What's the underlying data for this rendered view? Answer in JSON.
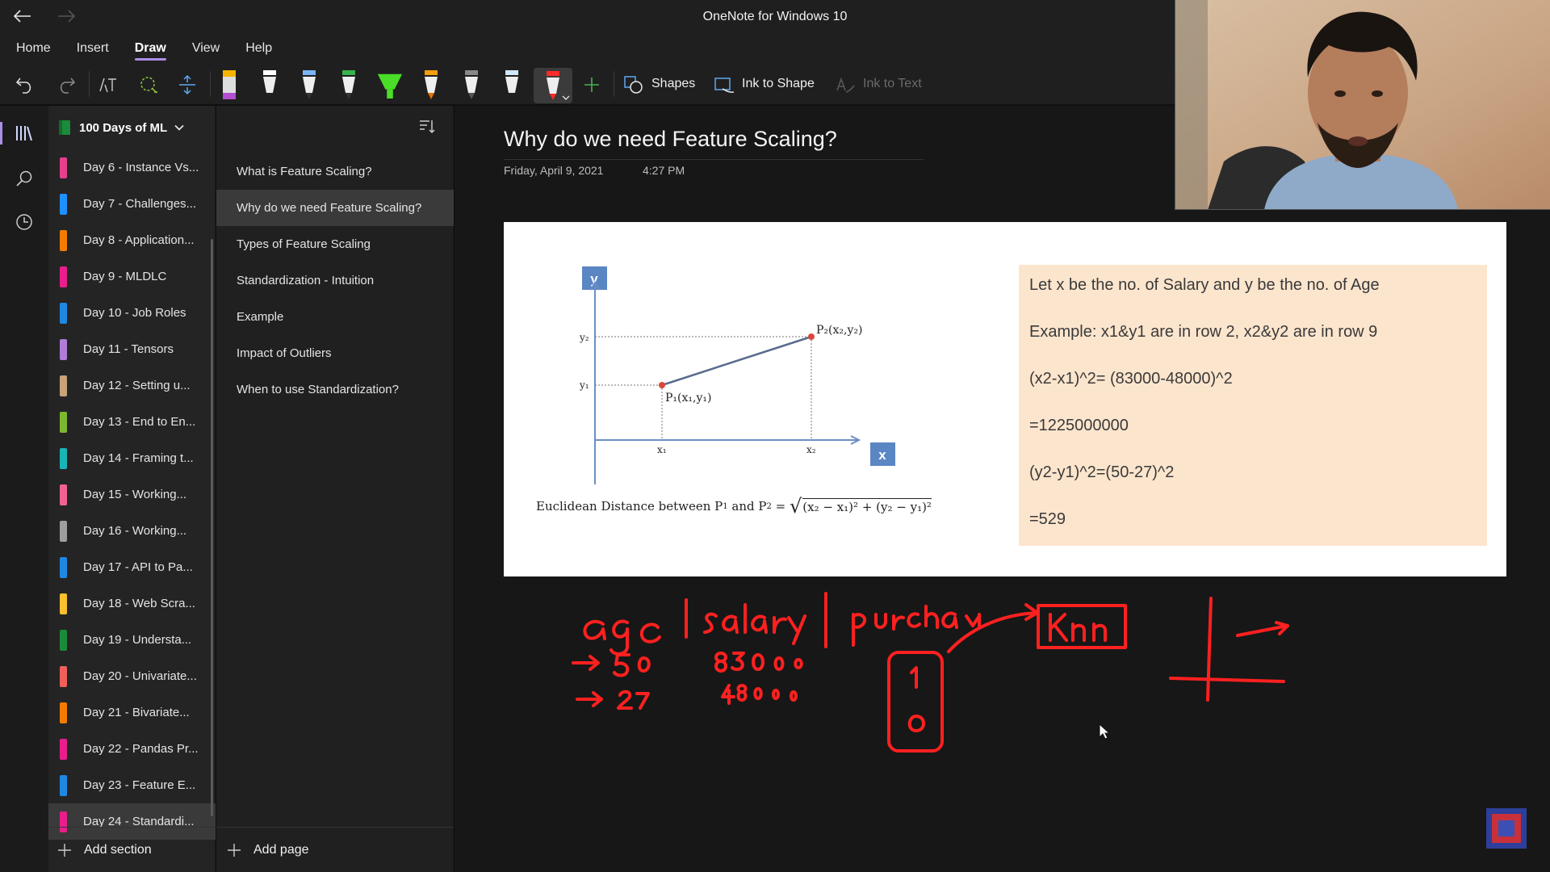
{
  "app": {
    "title": "OneNote for Windows 10"
  },
  "menu": {
    "tabs": [
      {
        "label": "Home"
      },
      {
        "label": "Insert"
      },
      {
        "label": "Draw"
      },
      {
        "label": "View"
      },
      {
        "label": "Help"
      }
    ],
    "active": "Draw"
  },
  "toolbar": {
    "shapes_label": "Shapes",
    "ink_to_shape_label": "Ink to Shape",
    "ink_to_text_label": "Ink to Text",
    "pens": [
      {
        "color": "#f4b400",
        "name": "highlighter-pen"
      },
      {
        "color": "#ffffff",
        "name": "white-pen"
      },
      {
        "color": "#7ab4f5",
        "name": "blue-pen"
      },
      {
        "color": "#37b24d",
        "name": "green-pen"
      },
      {
        "color": "#4ade28",
        "name": "green-highlighter"
      },
      {
        "color": "#f59e0b",
        "name": "orange-pen"
      },
      {
        "color": "#d0d0d0",
        "name": "gray-pen"
      },
      {
        "color": "#cfe8ff",
        "name": "light-blue-pen"
      },
      {
        "color": "#ff2a2a",
        "name": "red-pen"
      }
    ]
  },
  "notebook": {
    "name": "100 Days of ML"
  },
  "sections": [
    {
      "label": "Day 6 - Instance Vs...",
      "color": "#e83e8c"
    },
    {
      "label": "Day 7 - Challenges...",
      "color": "#1e90ff"
    },
    {
      "label": "Day 8 - Application...",
      "color": "#f57c00"
    },
    {
      "label": "Day 9 - MLDLC",
      "color": "#e91e8c"
    },
    {
      "label": "Day 10 - Job Roles",
      "color": "#1e88e5"
    },
    {
      "label": "Day 11 - Tensors",
      "color": "#b07cd8"
    },
    {
      "label": "Day 12 - Setting u...",
      "color": "#c9a27a"
    },
    {
      "label": "Day 13 - End to En...",
      "color": "#7cb82f"
    },
    {
      "label": "Day 14 - Framing t...",
      "color": "#19b5b5"
    },
    {
      "label": "Day 15 - Working...",
      "color": "#f06292"
    },
    {
      "label": "Day 16 - Working...",
      "color": "#9e9e9e"
    },
    {
      "label": "Day 17 - API to Pa...",
      "color": "#1e88e5"
    },
    {
      "label": "Day 18 - Web Scra...",
      "color": "#fbc02d"
    },
    {
      "label": "Day 19 - Understa...",
      "color": "#1b8a3a"
    },
    {
      "label": "Day 20 - Univariate...",
      "color": "#f0605a"
    },
    {
      "label": "Day 21 - Bivariate...",
      "color": "#f57c00"
    },
    {
      "label": "Day 22 - Pandas Pr...",
      "color": "#e91e8c"
    },
    {
      "label": "Day 23 - Feature E...",
      "color": "#1e88e5"
    },
    {
      "label": "Day 24 - Standardi...",
      "color": "#e91e8c"
    }
  ],
  "active_section": "Day 24 - Standardi...",
  "add_section_label": "Add section",
  "pages": [
    {
      "label": "What is Feature Scaling?"
    },
    {
      "label": "Why do we need Feature Scaling?"
    },
    {
      "label": "Types of Feature Scaling"
    },
    {
      "label": "Standardization - Intuition"
    },
    {
      "label": "Example"
    },
    {
      "label": "Impact of Outliers"
    },
    {
      "label": "When to use Standardization?"
    }
  ],
  "active_page": "Why do we need Feature Scaling?",
  "add_page_label": "Add page",
  "note": {
    "title": "Why do we need Feature Scaling?",
    "date": "Friday, April 9, 2021",
    "time": "4:27 PM",
    "diagram": {
      "y_axis": "y",
      "x_axis": "x",
      "y2": "y₂",
      "y1": "y₁",
      "x1": "x₁",
      "x2": "x₂",
      "p1": "P₁(x₁,y₁)",
      "p2": "P₂(x₂,y₂)",
      "formula_prefix": "Euclidean Distance between P",
      "formula_sub1": "1",
      "formula_and": " and P",
      "formula_sub2": "2",
      "formula_eq": " = ",
      "formula_sqrt": "(x₂ − x₁)² + (y₂ − y₁)²"
    },
    "textbox": [
      "Let x be the no. of Salary and  y be the no. of Age",
      "Example: x1&y1 are in row 2, x2&y2 are in row 9",
      "(x2-x1)^2= (83000-48000)^2",
      "=1225000000",
      "(y2-y1)^2=(50-27)^2",
      "=529"
    ],
    "ink_color": "#ff2020"
  }
}
